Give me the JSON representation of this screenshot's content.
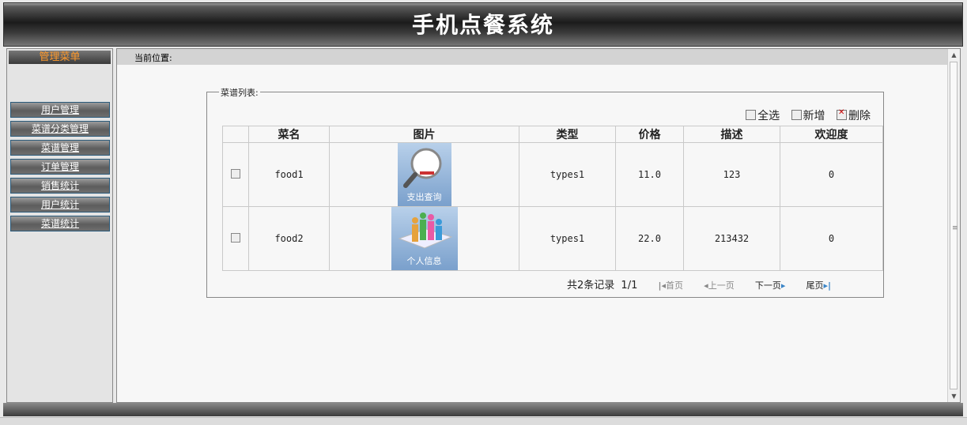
{
  "header": {
    "title": "手机点餐系统"
  },
  "sidebar": {
    "heading": "管理菜单",
    "items": [
      {
        "label": "用户管理"
      },
      {
        "label": "菜谱分类管理"
      },
      {
        "label": "菜谱管理"
      },
      {
        "label": "订单管理"
      },
      {
        "label": "销售统计"
      },
      {
        "label": "用户统计"
      },
      {
        "label": "菜谱统计"
      }
    ]
  },
  "content": {
    "breadcrumb_label": "当前位置:",
    "fieldset_legend": "菜谱列表:",
    "toolbar": {
      "select_all": "全选",
      "add": "新增",
      "delete": "删除"
    },
    "table": {
      "headers": [
        "",
        "菜名",
        "图片",
        "类型",
        "价格",
        "描述",
        "欢迎度"
      ],
      "rows": [
        {
          "name": "food1",
          "image_caption": "支出查询",
          "type": "types1",
          "price": "11.0",
          "description": "123",
          "popularity": "0"
        },
        {
          "name": "food2",
          "image_caption": "个人信息",
          "type": "types1",
          "price": "22.0",
          "description": "213432",
          "popularity": "0"
        }
      ]
    },
    "pager": {
      "total": "共2条记录",
      "page": "1/1",
      "first": "首页",
      "prev": "上一页",
      "next": "下一页",
      "last": "尾页"
    }
  }
}
